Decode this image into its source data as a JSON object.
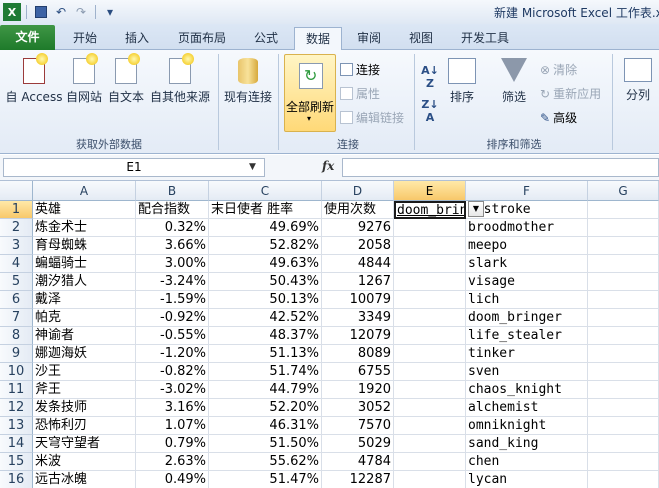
{
  "title_bar": {
    "app_title": "新建 Microsoft Excel 工作表.x"
  },
  "quick_access": {
    "save": "save-icon",
    "undo": "↶",
    "redo": "↷",
    "customize": "▾"
  },
  "tabs": [
    "文件",
    "开始",
    "插入",
    "页面布局",
    "公式",
    "数据",
    "审阅",
    "视图",
    "开发工具"
  ],
  "active_tab": "数据",
  "ribbon": {
    "from_access": "自 Access",
    "from_web": "自网站",
    "from_text": "自文本",
    "from_other": "自其他来源",
    "existing_conn": "现有连接",
    "refresh_all": "全部刷新",
    "connections": "连接",
    "properties": "属性",
    "edit_links": "编辑链接",
    "sort": "排序",
    "filter": "筛选",
    "clear": "清除",
    "reapply": "重新应用",
    "advanced": "高级",
    "split": "分列",
    "group_external": "获取外部数据",
    "group_connections": "连接",
    "group_sort": "排序和筛选"
  },
  "formula_bar": {
    "name_box": "E1",
    "fx": "fx",
    "formula": ""
  },
  "columns": [
    "A",
    "B",
    "C",
    "D",
    "E",
    "F",
    "G"
  ],
  "selected_column": "E",
  "selected_cell": "E1",
  "rows": [
    {
      "n": "1",
      "a": "英雄",
      "b": "配合指数",
      "c": "末日使者 胜率",
      "d": "使用次数",
      "e": "doom_brin",
      "f": "imstroke"
    },
    {
      "n": "2",
      "a": "炼金术士",
      "b": "0.32%",
      "c": "49.69%",
      "d": "9276",
      "e": "",
      "f": "broodmother"
    },
    {
      "n": "3",
      "a": "育母蜘蛛",
      "b": "3.66%",
      "c": "52.82%",
      "d": "2058",
      "e": "",
      "f": "meepo"
    },
    {
      "n": "4",
      "a": "蝙蝠骑士",
      "b": "3.00%",
      "c": "49.63%",
      "d": "4844",
      "e": "",
      "f": "slark"
    },
    {
      "n": "5",
      "a": "潮汐猎人",
      "b": "-3.24%",
      "c": "50.43%",
      "d": "1267",
      "e": "",
      "f": "visage"
    },
    {
      "n": "6",
      "a": "戴泽",
      "b": "-1.59%",
      "c": "50.13%",
      "d": "10079",
      "e": "",
      "f": "lich"
    },
    {
      "n": "7",
      "a": "帕克",
      "b": "-0.92%",
      "c": "42.52%",
      "d": "3349",
      "e": "",
      "f": "doom_bringer"
    },
    {
      "n": "8",
      "a": "神谕者",
      "b": "-0.55%",
      "c": "48.37%",
      "d": "12079",
      "e": "",
      "f": "life_stealer"
    },
    {
      "n": "9",
      "a": "娜迦海妖",
      "b": "-1.20%",
      "c": "51.13%",
      "d": "8089",
      "e": "",
      "f": "tinker"
    },
    {
      "n": "10",
      "a": "沙王",
      "b": "-0.82%",
      "c": "51.74%",
      "d": "6755",
      "e": "",
      "f": "sven"
    },
    {
      "n": "11",
      "a": "斧王",
      "b": "-3.02%",
      "c": "44.79%",
      "d": "1920",
      "e": "",
      "f": "chaos_knight"
    },
    {
      "n": "12",
      "a": "发条技师",
      "b": "3.16%",
      "c": "52.20%",
      "d": "3052",
      "e": "",
      "f": "alchemist"
    },
    {
      "n": "13",
      "a": "恐怖利刃",
      "b": "1.07%",
      "c": "46.31%",
      "d": "7570",
      "e": "",
      "f": "omniknight"
    },
    {
      "n": "14",
      "a": "天穹守望者",
      "b": "0.79%",
      "c": "51.50%",
      "d": "5029",
      "e": "",
      "f": "sand_king"
    },
    {
      "n": "15",
      "a": "米波",
      "b": "2.63%",
      "c": "55.62%",
      "d": "4784",
      "e": "",
      "f": "chen"
    },
    {
      "n": "16",
      "a": "远古冰魄",
      "b": "0.49%",
      "c": "51.47%",
      "d": "12287",
      "e": "",
      "f": "lycan"
    }
  ]
}
